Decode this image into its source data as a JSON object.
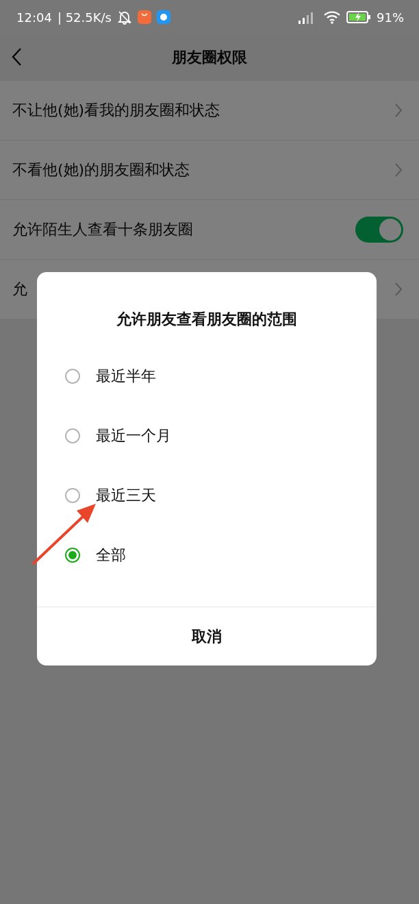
{
  "status_bar": {
    "time": "12:04",
    "speed": "| 52.5K/s",
    "battery": "91%"
  },
  "header": {
    "title": "朋友圈权限"
  },
  "settings": [
    {
      "kind": "link",
      "label": "不让他(她)看我的朋友圈和状态"
    },
    {
      "kind": "link",
      "label": "不看他(她)的朋友圈和状态"
    },
    {
      "kind": "switch",
      "label": "允许陌生人查看十条朋友圈",
      "on": true
    },
    {
      "kind": "link",
      "label": "允"
    }
  ],
  "dialog": {
    "title": "允许朋友查看朋友圈的范围",
    "options": [
      {
        "label": "最近半年",
        "selected": false
      },
      {
        "label": "最近一个月",
        "selected": false
      },
      {
        "label": "最近三天",
        "selected": false
      },
      {
        "label": "全部",
        "selected": true
      }
    ],
    "cancel": "取消"
  }
}
